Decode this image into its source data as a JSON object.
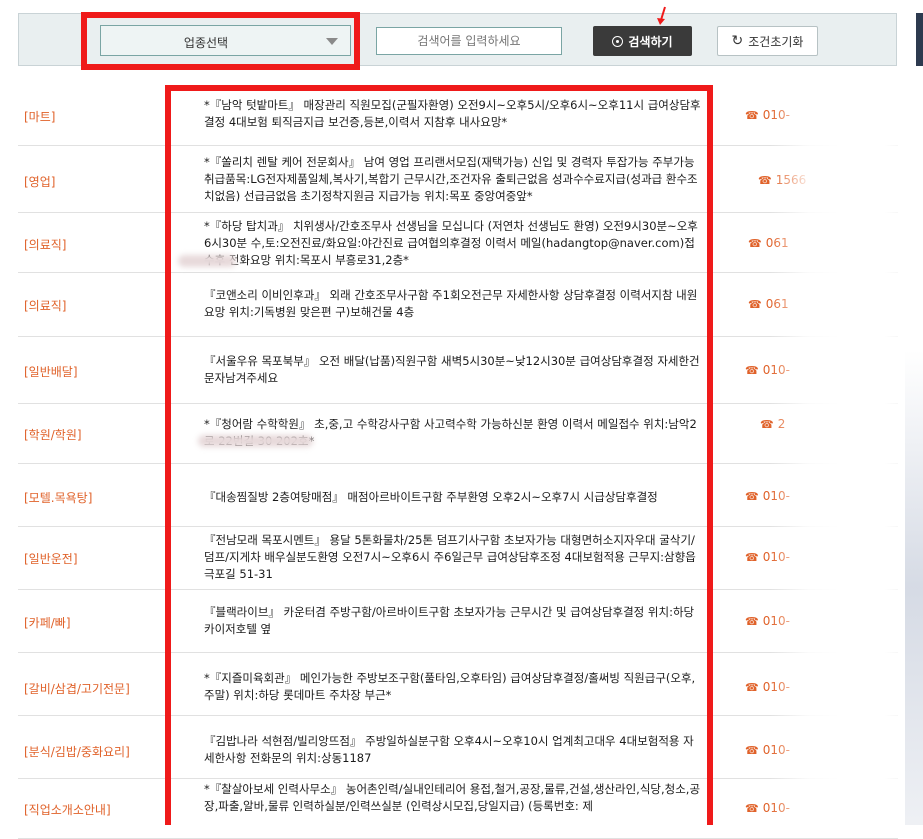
{
  "toolbar": {
    "category_select": "업종선택",
    "search_placeholder": "검색어를 입력하세요",
    "search_button": "검색하기",
    "reset_button": "조건초기화"
  },
  "phone_icon": "☎",
  "listings": [
    {
      "category": "[마트]",
      "description": "*『남악 텃밭마트』 매장관리 직원모집(군필자환영) 오전9시~오후5시/오후6시~오후11시 급여상담후결정 4대보험 퇴직금지급 보건증,등본,이력서 지참후 내사요망*",
      "phone": "010-"
    },
    {
      "category": "[영업]",
      "description": "*『쏠리치 렌탈 케어 전문회사』 남여 영업 프리랜서모집(재택가능) 신입 및 경력자 투잡가능 주부가능 취급품목:LG전자제품일체,복사기,복합기 근무시간,조건자유 출퇴근없음 성과수수료지급(성과급 환수조치없음) 선급금없음 초기정착지원금 지급가능 위치:목포 중앙여중앞*",
      "phone": "1566"
    },
    {
      "category": "[의료직]",
      "description": "*『하당 탑치과』 치위생사/간호조무사 선생님을 모십니다 (저연차 선생님도 환영) 오전9시30분~오후6시30분 수,토:오전진료/화요일:야간진료 급여협의후결정 이력서 메일(hadangtop@naver.com)접수후 전화요망 위치:목포시 부흥로31,2층*",
      "phone": "061"
    },
    {
      "category": "[의료직]",
      "description": "『코앤소리 이비인후과』 외래 간호조무사구함 주1회오전근무 자세한사항 상담후결정 이력서지참 내원요망 위치:기독병원 맞은편 구)보해건물 4층",
      "phone": "061"
    },
    {
      "category": "[일반배달]",
      "description": "『서울우유 목포북부』 오전 배달(납품)직원구함 새벽5시30분~낮12시30분 급여상담후결정 자세한건 문자남겨주세요",
      "phone": "010-"
    },
    {
      "category": "[학원/학원]",
      "description": "*『청어람 수학학원』 초,중,고 수학강사구함 사고력수학 가능하신분 환영 이력서 메일접수 위치:남악2로 22번길 30 202호*",
      "phone": "2"
    },
    {
      "category": "[모텔.목욕탕]",
      "description": "『대송찜질방 2층여탕매점』 매점아르바이트구함 주부환영 오후2시~오후7시 시급상담후결정",
      "phone": "010-"
    },
    {
      "category": "[일반운전]",
      "description": "『전남모래 목포시멘트』 용달 5톤화물차/25톤 덤프기사구함 초보자가능 대형면허소지자우대 굴삭기/덤프/지게차 배우실분도환영 오전7시~오후6시 주6일근무 급여상담후조정 4대보험적용 근무지:삼향읍 극포길 51-31",
      "phone": "010-"
    },
    {
      "category": "[카페/빠]",
      "description": "『블랙라이브』 카운터겸 주방구함/아르바이트구함 초보자가능 근무시간 및 급여상담후결정 위치:하당 카이저호텔 옆",
      "phone": "010-"
    },
    {
      "category": "[갈비/삼겹/고기전문]",
      "description": "*『지즐미육회관』 메인가능한 주방보조구함(풀타임,오후타임) 급여상담후결정/홀써빙 직원급구(오후,주말) 위치:하당 롯데마트 주차장 부근*",
      "phone": "010-"
    },
    {
      "category": "[분식/김밥/중화요리]",
      "description": "『김밥나라 석현점/빌리앙뜨점』 주방일하실분구함 오후4시~오후10시 업계최고대우 4대보험적용 자세한사항 전화문의 위치:상동1187",
      "phone": "010-"
    },
    {
      "category": "[직업소개소안내]",
      "description": "*『찰살아보세 인력사무소』 농어촌인력/실내인테리어 용접,철거,공장,물류,건설,생산라인,식당,청소,공장,파출,알바,물류 인력하실분/인력쓰실분 (인력상시모집,당일지급) (등록번호: 제",
      "phone": "010-"
    }
  ]
}
